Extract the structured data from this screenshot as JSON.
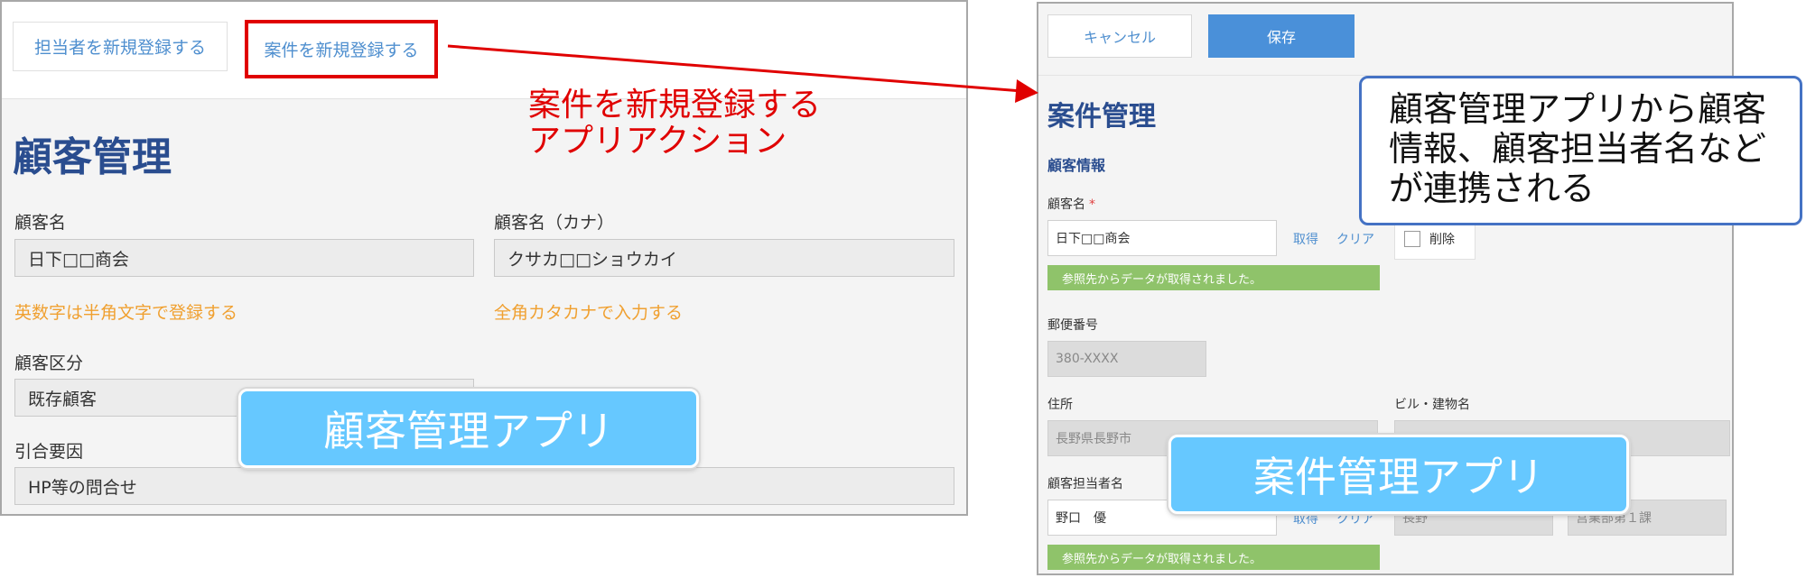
{
  "customer_app": {
    "buttons": {
      "register_contact": "担当者を新規登録する",
      "register_case": "案件を新規登録する"
    },
    "title": "顧客管理",
    "fields": {
      "customer_name": {
        "label": "顧客名",
        "value": "日下□□商会",
        "hint": "英数字は半角文字で登録する"
      },
      "customer_name_kana": {
        "label": "顧客名（カナ）",
        "value": "クサカ□□ショウカイ",
        "hint": "全角カタカナで入力する"
      },
      "customer_type": {
        "label": "顧客区分",
        "value": "既存顧客"
      },
      "inquiry_source": {
        "label": "引合要因",
        "value": "HP等の問合せ"
      }
    },
    "badge": "顧客管理アプリ"
  },
  "case_app": {
    "buttons": {
      "cancel": "キャンセル",
      "save": "保存"
    },
    "title": "案件管理",
    "section": "顧客情報",
    "customer_name": {
      "label": "顧客名",
      "required_mark": "*",
      "value": "日下□□商会",
      "get_link": "取得",
      "clear_link": "クリア",
      "delete_label": "削除",
      "success_msg": "参照先からデータが取得されました。"
    },
    "postal_code": {
      "label": "郵便番号",
      "value": "380-XXXX"
    },
    "address": {
      "label": "住所",
      "value": "長野県長野市"
    },
    "building": {
      "label": "ビル・建物名",
      "value": ""
    },
    "contact": {
      "label": "顧客担当者名",
      "value": "野口　優",
      "get_link": "取得",
      "clear_link": "クリア",
      "field2_value": "長野",
      "field3_value": "営業部第１課",
      "success_msg": "参照先からデータが取得されました。"
    },
    "badge": "案件管理アプリ"
  },
  "annotations": {
    "action_label": "案件を新規登録する\nアプリアクション",
    "callout": "顧客管理アプリから顧客\n情報、顧客担当者名など\nが連携される"
  },
  "colors": {
    "link_blue": "#4f8fcf",
    "title_navy": "#2a4d8f",
    "hint_orange": "#f0a030",
    "highlight_red": "#e00000",
    "badge_blue": "#66c8ff",
    "save_blue": "#4a90d9",
    "success_green": "#8fc36a",
    "callout_border": "#4472c4"
  },
  "icons": {
    "arrow": "arrow-right-icon"
  }
}
